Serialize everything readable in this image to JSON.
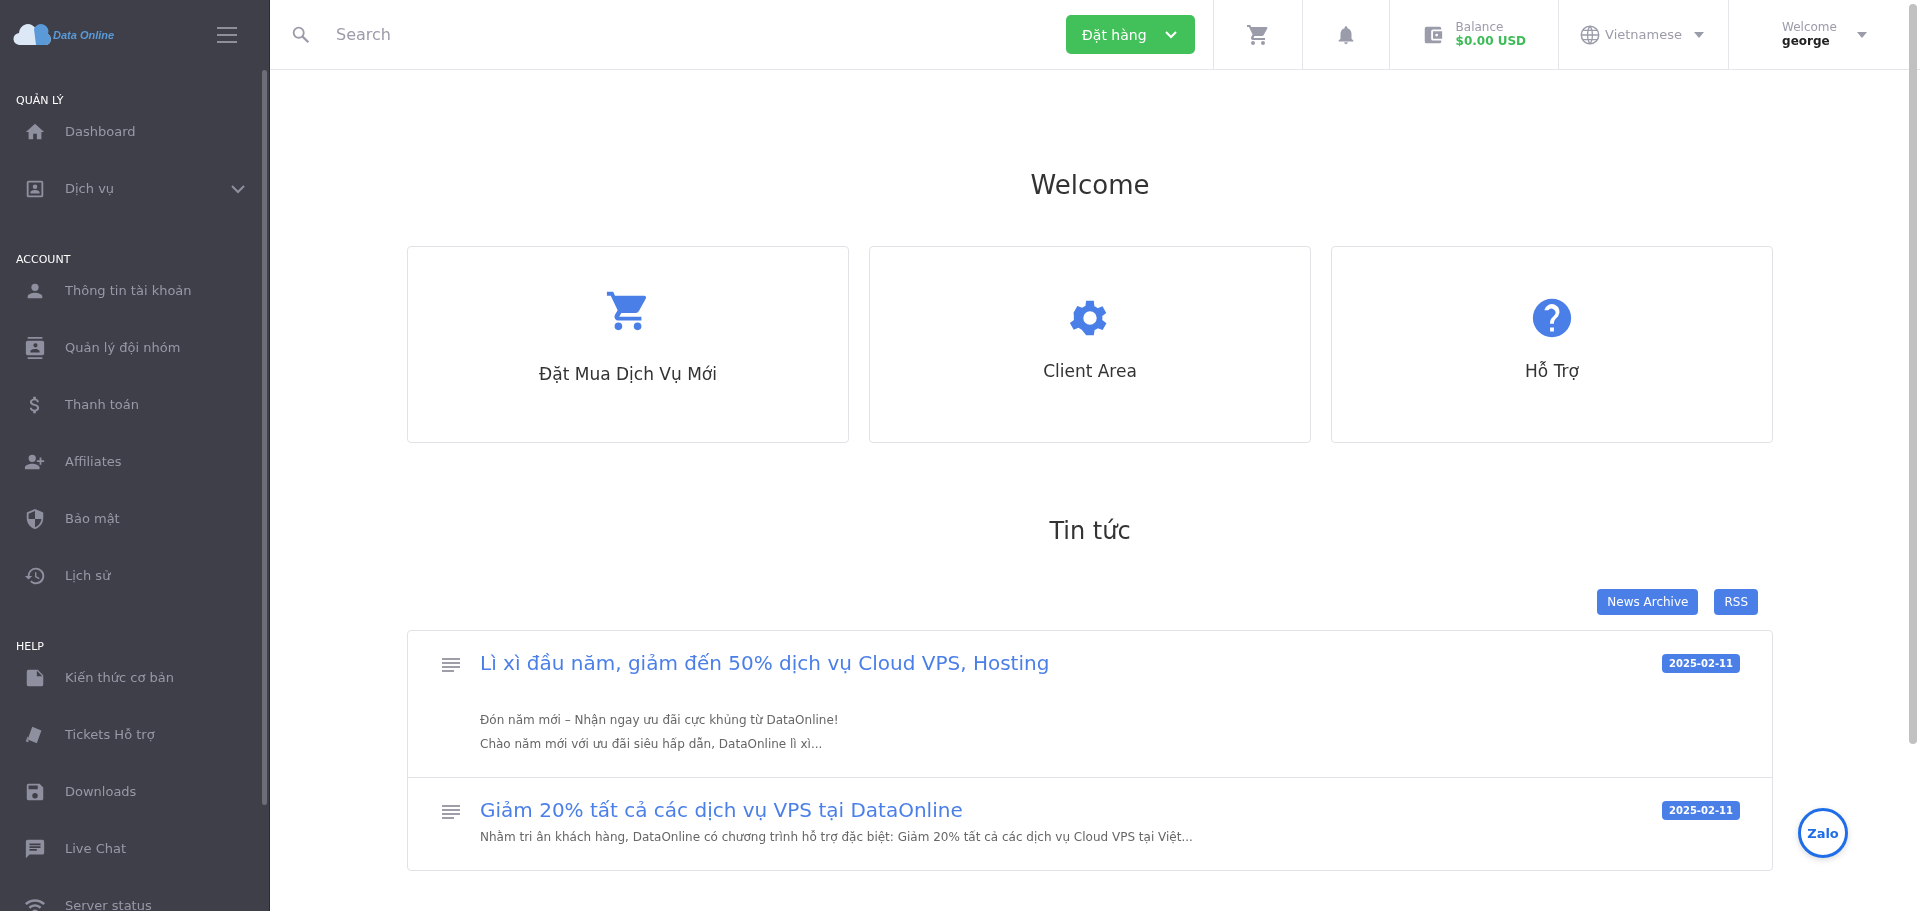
{
  "sidebar": {
    "logo": "Data Online",
    "groups": [
      {
        "title": "QUẢN LÝ",
        "items": [
          {
            "label": "Dashboard"
          },
          {
            "label": "Dịch vụ",
            "expanded": false
          }
        ]
      },
      {
        "title": "ACCOUNT",
        "items": [
          {
            "label": "Thông tin tài khoản"
          },
          {
            "label": "Quản lý đội nhóm"
          },
          {
            "label": "Thanh toán"
          },
          {
            "label": "Affiliates"
          },
          {
            "label": "Bảo mật"
          },
          {
            "label": "Lịch sử"
          }
        ]
      },
      {
        "title": "HELP",
        "items": [
          {
            "label": "Kiến thức cơ bản"
          },
          {
            "label": "Tickets Hỗ trợ"
          },
          {
            "label": "Downloads"
          },
          {
            "label": "Live Chat"
          },
          {
            "label": "Server status"
          }
        ]
      }
    ]
  },
  "header": {
    "search": {
      "placeholder": "Search"
    },
    "order_button": "Đặt hàng",
    "balance": {
      "label": "Balance",
      "value": "$0.00 USD"
    },
    "language": "Vietnamese",
    "user": {
      "greeting": "Welcome",
      "name": "george"
    }
  },
  "welcome": {
    "title": "Welcome",
    "cards": [
      {
        "label": "Đặt Mua Dịch Vụ Mới"
      },
      {
        "label": "Client Area"
      },
      {
        "label": "Hỗ Trợ"
      }
    ]
  },
  "news": {
    "title": "Tin tức",
    "buttons": [
      "News Archive",
      "RSS"
    ],
    "items": [
      {
        "title": "Lì xì đầu năm, giảm đến 50% dịch vụ Cloud VPS, Hosting",
        "date": "2025-02-11",
        "excerpt": [
          "Đón năm mới – Nhận ngay ưu đãi cực khủng từ DataOnline!",
          "Chào năm mới với ưu đãi siêu hấp dẫn, DataOnline lì xì..."
        ]
      },
      {
        "title": "Giảm 20% tất cả các dịch vụ VPS tại DataOnline",
        "date": "2025-02-11",
        "excerpt": [
          "Nhằm tri ân khách hàng, DataOnline có chương trình hỗ trợ đặc biệt: Giảm 20% tất cả các dịch vụ Cloud VPS tại Việt..."
        ]
      }
    ]
  },
  "chat_widget": {
    "label": "Zalo"
  }
}
